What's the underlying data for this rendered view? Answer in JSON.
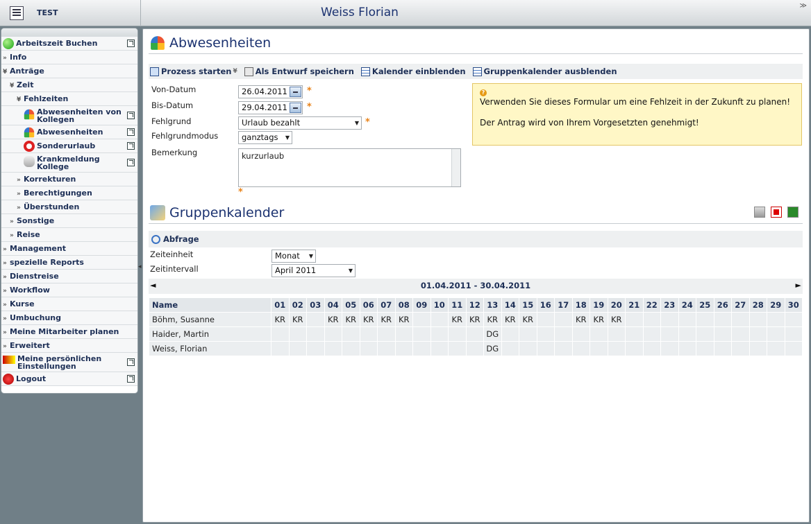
{
  "header": {
    "app_name": "TEST",
    "user_name": "Weiss Florian",
    "collapse": "≫"
  },
  "sidebar": {
    "items": [
      {
        "key": "arbeitszeit",
        "label": "Arbeitszeit Buchen",
        "icon": "green-ball-icon",
        "level": 0,
        "ext": true
      },
      {
        "key": "info",
        "label": "Info",
        "level": 0,
        "chev": "»"
      },
      {
        "key": "antraege",
        "label": "Anträge",
        "level": 0,
        "chev": "¥"
      },
      {
        "key": "zeit",
        "label": "Zeit",
        "level": 1,
        "chev": "¥"
      },
      {
        "key": "fehlzeiten",
        "label": "Fehlzeiten",
        "level": 2,
        "chev": "¥"
      },
      {
        "key": "abw-kollegen",
        "label": "Abwesenheiten von Kollegen",
        "icon": "umbrella-icon",
        "level": 3,
        "ext": true,
        "tall": true
      },
      {
        "key": "abwesenheiten",
        "label": "Abwesenheiten",
        "icon": "umbrella-icon",
        "level": 3,
        "ext": true
      },
      {
        "key": "sonderurlaub",
        "label": "Sonderurlaub",
        "icon": "lifering-icon",
        "level": 3,
        "ext": true
      },
      {
        "key": "krankmeldung",
        "label": "Krankmeldung Kollege",
        "icon": "sick-person-icon",
        "level": 3,
        "ext": true,
        "tall": true
      },
      {
        "key": "korrekturen",
        "label": "Korrekturen",
        "level": 2,
        "chev": "»"
      },
      {
        "key": "berechtigungen",
        "label": "Berechtigungen",
        "level": 2,
        "chev": "»"
      },
      {
        "key": "ueberstunden",
        "label": "Überstunden",
        "level": 2,
        "chev": "»"
      },
      {
        "key": "sonstige",
        "label": "Sonstige",
        "level": 1,
        "chev": "»"
      },
      {
        "key": "reise",
        "label": "Reise",
        "level": 1,
        "chev": "»"
      },
      {
        "key": "management",
        "label": "Management",
        "level": 0,
        "chev": "»"
      },
      {
        "key": "reports",
        "label": "spezielle Reports",
        "level": 0,
        "chev": "»"
      },
      {
        "key": "dienstreise",
        "label": "Dienstreise",
        "level": 0,
        "chev": "»"
      },
      {
        "key": "workflow",
        "label": "Workflow",
        "level": 0,
        "chev": "»"
      },
      {
        "key": "kurse",
        "label": "Kurse",
        "level": 0,
        "chev": "»"
      },
      {
        "key": "umbuchung",
        "label": "Umbuchung",
        "level": 0,
        "chev": "»"
      },
      {
        "key": "mitarbeiter",
        "label": "Meine Mitarbeiter planen",
        "level": 0,
        "chev": "»"
      },
      {
        "key": "erweitert",
        "label": "Erweitert",
        "level": 0,
        "chev": "»"
      },
      {
        "key": "einstellungen",
        "label": "Meine persönlichen Einstellungen",
        "icon": "settings-icon",
        "level": 0,
        "ext": true,
        "tall": true
      },
      {
        "key": "logout",
        "label": "Logout",
        "icon": "logout-icon",
        "level": 0,
        "ext": true
      }
    ]
  },
  "abwesenheiten": {
    "title": "Abwesenheiten",
    "toolbar": {
      "start": "Prozess starten",
      "start_dd": "¥",
      "draft": "Als Entwurf speichern",
      "show_cal": "Kalender einblenden",
      "hide_group": "Gruppenkalender ausblenden"
    },
    "form": {
      "von_label": "Von-Datum",
      "von_value": "26.04.2011",
      "bis_label": "Bis-Datum",
      "bis_value": "29.04.2011",
      "grund_label": "Fehlgrund",
      "grund_value": "Urlaub bezahlt",
      "modus_label": "Fehlgrundmodus",
      "modus_value": "ganztags",
      "bemerkung_label": "Bemerkung",
      "bemerkung_value": "kurzurlaub",
      "required": "*"
    },
    "info": {
      "line1": "Verwenden Sie dieses Formular um eine Fehlzeit in der Zukunft zu planen!",
      "line2": "Der Antrag wird von Ihrem Vorgesetzten genehmigt!"
    }
  },
  "gruppenkalender": {
    "title": "Gruppenkalender",
    "abfrage": "Abfrage",
    "zeiteinheit_label": "Zeiteinheit",
    "zeiteinheit_value": "Monat",
    "zeitintervall_label": "Zeitintervall",
    "zeitintervall_value": "April 2011",
    "range": "01.04.2011 - 30.04.2011",
    "prev": "◄",
    "next": "►",
    "name_header": "Name",
    "days": [
      "01",
      "02",
      "03",
      "04",
      "05",
      "06",
      "07",
      "08",
      "09",
      "10",
      "11",
      "12",
      "13",
      "14",
      "15",
      "16",
      "17",
      "18",
      "19",
      "20",
      "21",
      "22",
      "23",
      "24",
      "25",
      "26",
      "27",
      "28",
      "29",
      "30"
    ],
    "day_types": [
      "",
      "we1",
      "we2",
      "",
      "",
      "",
      "",
      "",
      "we1",
      "we2",
      "",
      "",
      "",
      "",
      "",
      "we1",
      "we2",
      "",
      "",
      "",
      "",
      "",
      "we1",
      "we2",
      "hol",
      "",
      "",
      "",
      "",
      "we1"
    ],
    "rows": [
      {
        "name": "Böhm, Susanne",
        "cells": [
          "KR",
          "KR",
          "",
          "KR",
          "KR",
          "KR",
          "KR",
          "KR",
          "",
          "",
          "KR",
          "KR",
          "KR",
          "KR",
          "KR",
          "",
          "",
          "KR",
          "KR",
          "KR",
          "",
          "",
          "",
          "",
          "",
          "",
          "",
          "",
          "",
          ""
        ]
      },
      {
        "name": "Haider, Martin",
        "cells": [
          "",
          "",
          "",
          "",
          "",
          "",
          "",
          "",
          "",
          "",
          "",
          "",
          "DG",
          "",
          "",
          "",
          "",
          "",
          "",
          "",
          "",
          "",
          "",
          "",
          "",
          "",
          "",
          "",
          "",
          ""
        ]
      },
      {
        "name": "Weiss, Florian",
        "cells": [
          "",
          "",
          "",
          "",
          "",
          "",
          "",
          "",
          "",
          "",
          "",
          "",
          "DG",
          "",
          "",
          "",
          "",
          "",
          "",
          "",
          "",
          "",
          "",
          "",
          "",
          "",
          "",
          "",
          "",
          ""
        ]
      }
    ]
  }
}
